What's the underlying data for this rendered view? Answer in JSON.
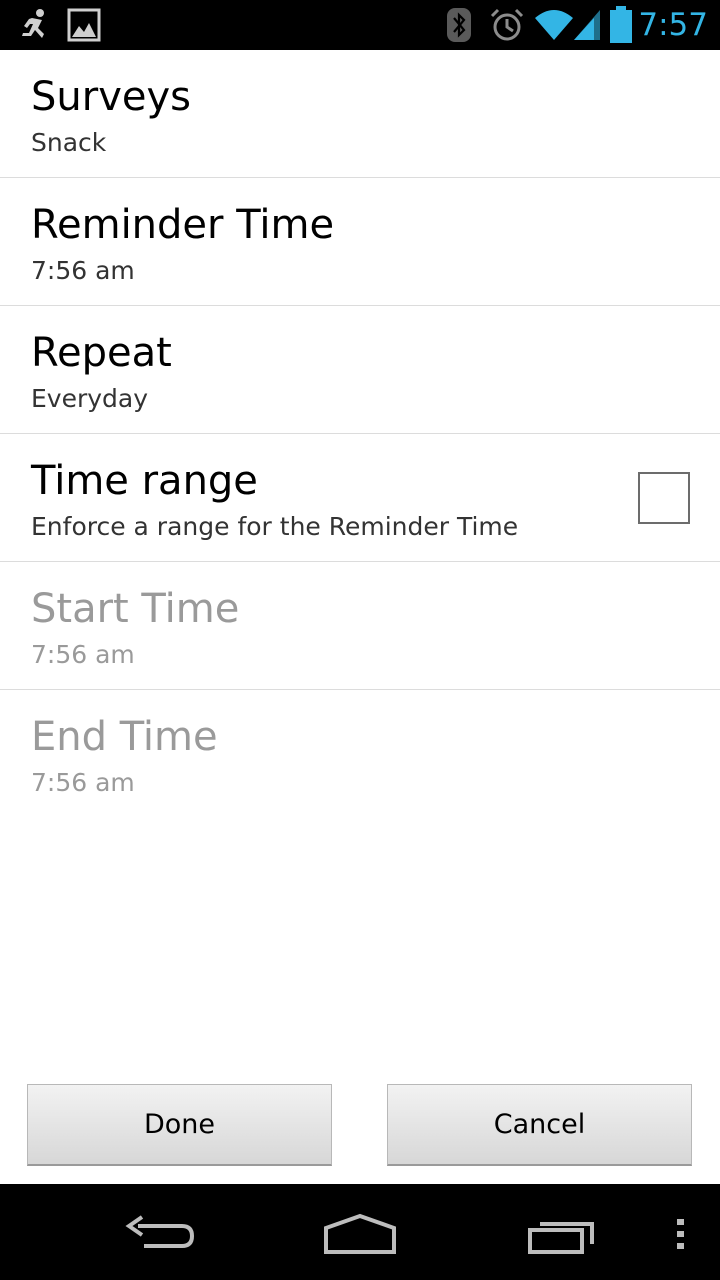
{
  "status_bar": {
    "time": "7:57",
    "left_icons": [
      "running-figure-icon",
      "image-icon"
    ],
    "right_icons": [
      "bluetooth-icon",
      "alarm-icon",
      "wifi-icon",
      "signal-icon",
      "battery-icon"
    ],
    "accent_color": "#33b5e5"
  },
  "preferences": [
    {
      "title": "Surveys",
      "summary": "Snack",
      "enabled": true
    },
    {
      "title": "Reminder Time",
      "summary": "7:56 am",
      "enabled": true
    },
    {
      "title": "Repeat",
      "summary": "Everyday",
      "enabled": true
    },
    {
      "title": "Time range",
      "summary": "Enforce a range for the Reminder Time",
      "enabled": true,
      "checked": false
    },
    {
      "title": "Start Time",
      "summary": "7:56 am",
      "enabled": false
    },
    {
      "title": "End Time",
      "summary": "7:56 am",
      "enabled": false
    }
  ],
  "buttons": {
    "done_label": "Done",
    "cancel_label": "Cancel"
  },
  "nav_bar": {
    "icons": [
      "back-icon",
      "home-icon",
      "recent-apps-icon",
      "menu-icon"
    ]
  }
}
